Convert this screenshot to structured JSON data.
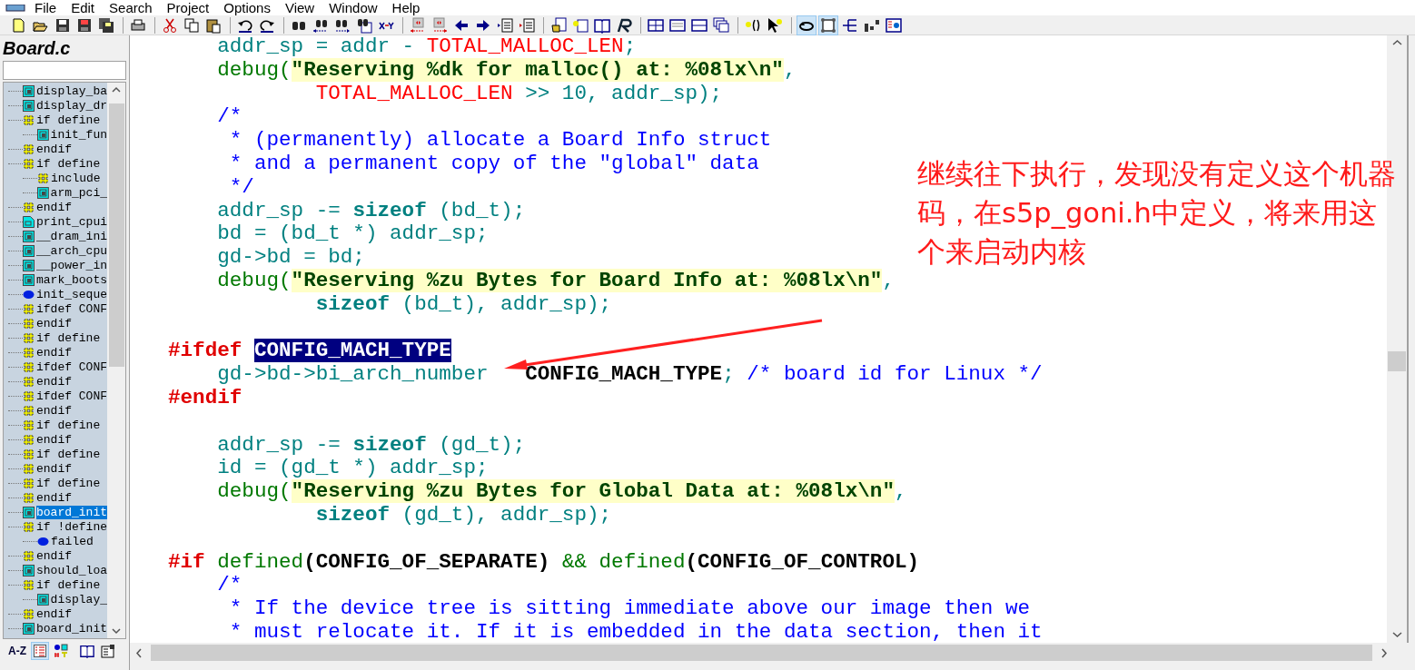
{
  "menu": [
    "File",
    "Edit",
    "Search",
    "Project",
    "Options",
    "View",
    "Window",
    "Help"
  ],
  "sidebar": {
    "title": "Board.c",
    "symbols": [
      {
        "kind": "func",
        "label": "display_ba",
        "selected": false
      },
      {
        "kind": "func",
        "label": "display_dr",
        "selected": false
      },
      {
        "kind": "hash",
        "label": "if define",
        "selected": false,
        "children": [
          {
            "kind": "func",
            "label": "init_fun",
            "selected": false
          }
        ]
      },
      {
        "kind": "hash",
        "label": "endif",
        "selected": false
      },
      {
        "kind": "hash",
        "label": "if define",
        "selected": false,
        "children": [
          {
            "kind": "hash",
            "label": "include",
            "selected": false
          },
          {
            "kind": "func",
            "label": "arm_pci_",
            "selected": false
          }
        ]
      },
      {
        "kind": "hash",
        "label": "endif",
        "selected": false
      },
      {
        "kind": "proto",
        "label": "print_cpui",
        "selected": false
      },
      {
        "kind": "func",
        "label": "__dram_ini",
        "selected": false
      },
      {
        "kind": "func",
        "label": "__arch_cpu",
        "selected": false
      },
      {
        "kind": "func",
        "label": "__power_in",
        "selected": false
      },
      {
        "kind": "func",
        "label": "mark_boots",
        "selected": false
      },
      {
        "kind": "var",
        "label": "init_seque",
        "selected": false
      },
      {
        "kind": "hash",
        "label": "ifdef CONF",
        "selected": false
      },
      {
        "kind": "hash",
        "label": "endif",
        "selected": false
      },
      {
        "kind": "hash",
        "label": "if define",
        "selected": false
      },
      {
        "kind": "hash",
        "label": "endif",
        "selected": false
      },
      {
        "kind": "hash",
        "label": "ifdef CONF",
        "selected": false
      },
      {
        "kind": "hash",
        "label": "endif",
        "selected": false
      },
      {
        "kind": "hash",
        "label": "ifdef CONF",
        "selected": false
      },
      {
        "kind": "hash",
        "label": "endif",
        "selected": false
      },
      {
        "kind": "hash",
        "label": "if define",
        "selected": false
      },
      {
        "kind": "hash",
        "label": "endif",
        "selected": false
      },
      {
        "kind": "hash",
        "label": "if define",
        "selected": false
      },
      {
        "kind": "hash",
        "label": "endif",
        "selected": false
      },
      {
        "kind": "hash",
        "label": "if define",
        "selected": false
      },
      {
        "kind": "hash",
        "label": "endif",
        "selected": false
      },
      {
        "kind": "func",
        "label": "board_init",
        "selected": true
      },
      {
        "kind": "hash",
        "label": "if !define",
        "selected": false,
        "children": [
          {
            "kind": "var",
            "label": "failed",
            "selected": false
          }
        ]
      },
      {
        "kind": "hash",
        "label": "endif",
        "selected": false
      },
      {
        "kind": "func",
        "label": "should_loa",
        "selected": false
      },
      {
        "kind": "hash",
        "label": "if define",
        "selected": false,
        "children": [
          {
            "kind": "func",
            "label": "display_",
            "selected": false
          }
        ]
      },
      {
        "kind": "hash",
        "label": "endif",
        "selected": false
      },
      {
        "kind": "func",
        "label": "board_init",
        "selected": false
      }
    ],
    "view_buttons": [
      {
        "kind": "az",
        "label": "A-Z",
        "selected": false
      },
      {
        "kind": "list",
        "selected": true
      },
      {
        "kind": "types",
        "selected": false
      },
      {
        "kind": "book",
        "selected": false
      },
      {
        "kind": "props",
        "selected": false
      }
    ]
  },
  "code_lines": [
    {
      "kind": "block",
      "tokens": [
        {
          "kind": "plain",
          "text": "addr_sp = addr - "
        },
        {
          "kind": "macro",
          "text": "TOTAL_MALLOC_LEN"
        },
        {
          "kind": "plain",
          "text": ";"
        }
      ]
    },
    {
      "kind": "block",
      "tokens": [
        {
          "kind": "call",
          "text": "debug("
        },
        {
          "kind": "string",
          "text": "\"Reserving %dk for malloc() at: %08lx\\n\""
        },
        {
          "kind": "plain",
          "text": ","
        }
      ]
    },
    {
      "kind": "wrap",
      "tokens": [
        {
          "kind": "macro",
          "text": "TOTAL_MALLOC_LEN"
        },
        {
          "kind": "plain",
          "text": " >> 10, addr_sp);"
        }
      ]
    },
    {
      "kind": "block",
      "tokens": [
        {
          "kind": "comment",
          "text": "/*"
        }
      ]
    },
    {
      "kind": "star",
      "tokens": [
        {
          "kind": "comment",
          "text": "* (permanently) allocate a Board Info struct"
        }
      ]
    },
    {
      "kind": "star",
      "tokens": [
        {
          "kind": "comment",
          "text": "* and a permanent copy of the \"global\" data"
        }
      ]
    },
    {
      "kind": "star",
      "tokens": [
        {
          "kind": "comment",
          "text": "*/"
        }
      ]
    },
    {
      "kind": "block",
      "tokens": [
        {
          "kind": "plain",
          "text": "addr_sp -= "
        },
        {
          "kind": "keyword",
          "text": "sizeof"
        },
        {
          "kind": "plain",
          "text": " (bd_t);"
        }
      ]
    },
    {
      "kind": "block",
      "tokens": [
        {
          "kind": "plain",
          "text": "bd = (bd_t *) addr_sp;"
        }
      ]
    },
    {
      "kind": "block",
      "tokens": [
        {
          "kind": "plain",
          "text": "gd->bd = bd;"
        }
      ]
    },
    {
      "kind": "block",
      "tokens": [
        {
          "kind": "call",
          "text": "debug("
        },
        {
          "kind": "string",
          "text": "\"Reserving %zu Bytes for Board Info at: %08lx\\n\""
        },
        {
          "kind": "plain",
          "text": ","
        }
      ]
    },
    {
      "kind": "wrap",
      "tokens": [
        {
          "kind": "keyword",
          "text": "sizeof"
        },
        {
          "kind": "plain",
          "text": " (bd_t), addr_sp);"
        }
      ]
    },
    {
      "kind": "blank"
    },
    {
      "kind": "flush",
      "tokens": [
        {
          "kind": "directive",
          "text": "#ifdef "
        },
        {
          "kind": "selection",
          "text": "CONFIG_MACH_TYPE"
        }
      ]
    },
    {
      "kind": "block",
      "tokens": [
        {
          "kind": "plain",
          "text": "gd->bd->bi_arch_number"
        },
        {
          "kind": "covered"
        },
        {
          "kind": "constant",
          "text": "CONFIG_MACH_TYPE"
        },
        {
          "kind": "plain",
          "text": "; "
        },
        {
          "kind": "comment",
          "text": "/* board id for Linux */"
        }
      ]
    },
    {
      "kind": "flush",
      "tokens": [
        {
          "kind": "directive",
          "text": "#endif"
        }
      ]
    },
    {
      "kind": "blank"
    },
    {
      "kind": "block",
      "tokens": [
        {
          "kind": "plain",
          "text": "addr_sp -= "
        },
        {
          "kind": "keyword",
          "text": "sizeof"
        },
        {
          "kind": "plain",
          "text": " (gd_t);"
        }
      ]
    },
    {
      "kind": "block",
      "tokens": [
        {
          "kind": "plain",
          "text": "id = (gd_t *) addr_sp;"
        }
      ]
    },
    {
      "kind": "block",
      "tokens": [
        {
          "kind": "call",
          "text": "debug("
        },
        {
          "kind": "string",
          "text": "\"Reserving %zu Bytes for Global Data at: %08lx\\n\""
        },
        {
          "kind": "plain",
          "text": ","
        }
      ]
    },
    {
      "kind": "wrap",
      "tokens": [
        {
          "kind": "keyword",
          "text": "sizeof"
        },
        {
          "kind": "plain",
          "text": " (gd_t), addr_sp);"
        }
      ]
    },
    {
      "kind": "blank"
    },
    {
      "kind": "flush",
      "tokens": [
        {
          "kind": "directive",
          "text": "#if "
        },
        {
          "kind": "call",
          "text": "defined"
        },
        {
          "kind": "constant",
          "text": "(CONFIG_OF_SEPARATE)"
        },
        {
          "kind": "call",
          "text": " && defined"
        },
        {
          "kind": "constant",
          "text": "(CONFIG_OF_CONTROL)"
        }
      ]
    },
    {
      "kind": "block",
      "tokens": [
        {
          "kind": "comment",
          "text": "/*"
        }
      ]
    },
    {
      "kind": "star",
      "tokens": [
        {
          "kind": "comment",
          "text": "* If the device tree is sitting immediate above our image then we"
        }
      ]
    },
    {
      "kind": "star",
      "tokens": [
        {
          "kind": "comment",
          "text": "* must relocate it. If it is embedded in the data section, then it"
        }
      ]
    }
  ],
  "annotation": {
    "text": "继续往下执行，发现没有定义这个机器码，在s5p_goni.h中定义，将来用这个来启动内核"
  }
}
